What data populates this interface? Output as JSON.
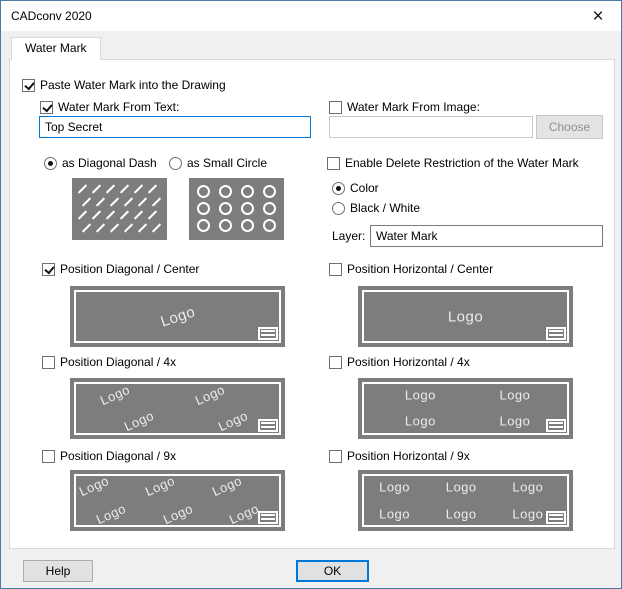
{
  "window": {
    "title": "CADconv 2020",
    "close_glyph": "×"
  },
  "tabs": [
    {
      "label": "Water Mark",
      "selected": true
    }
  ],
  "watermark": {
    "paste_label": "Paste Water Mark into the Drawing",
    "paste_checked": true,
    "from_text_label": "Water Mark From Text:",
    "from_text_checked": true,
    "text_value": "Top Secret",
    "from_image_label": "Water Mark From Image:",
    "from_image_checked": false,
    "image_value": "",
    "choose_label": "Choose",
    "choose_enabled": false,
    "style_options": [
      {
        "label": "as Diagonal Dash",
        "selected": true
      },
      {
        "label": "as Small Circle",
        "selected": false
      }
    ],
    "delete_restriction_label": "Enable Delete Restriction of the Water Mark",
    "delete_restriction_checked": false,
    "color_options": [
      {
        "label": "Color",
        "selected": true
      },
      {
        "label": "Black / White",
        "selected": false
      }
    ],
    "layer_label": "Layer:",
    "layer_value": "Water Mark",
    "logo_text": "Logo",
    "positions": [
      {
        "label": "Position Diagonal / Center",
        "checked": true,
        "layout": "diagonal-1"
      },
      {
        "label": "Position Horizontal / Center",
        "checked": false,
        "layout": "horizontal-1"
      },
      {
        "label": "Position Diagonal / 4x",
        "checked": false,
        "layout": "diagonal-4"
      },
      {
        "label": "Position Horizontal / 4x",
        "checked": false,
        "layout": "horizontal-4"
      },
      {
        "label": "Position Diagonal / 9x",
        "checked": false,
        "layout": "diagonal-9"
      },
      {
        "label": "Position Horizontal / 9x",
        "checked": false,
        "layout": "horizontal-9"
      }
    ]
  },
  "footer": {
    "help_label": "Help",
    "ok_label": "OK"
  },
  "colors": {
    "accent": "#0078d7",
    "preview_background": "#7d7d7d",
    "preview_foreground": "#ffffff"
  }
}
